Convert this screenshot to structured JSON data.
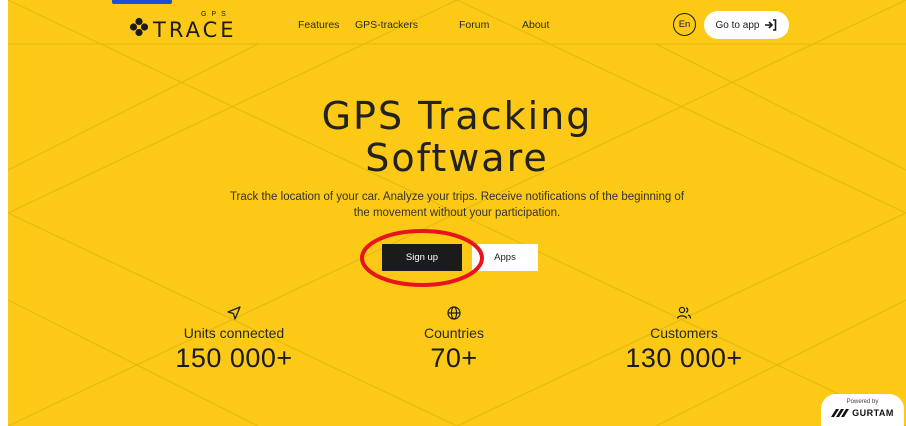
{
  "header": {
    "logo_main": "TRACE",
    "logo_sup": "GPS",
    "nav": {
      "features": "Features",
      "trackers": "GPS-trackers",
      "forum": "Forum",
      "about": "About"
    },
    "language": "En",
    "goto_label": "Go to app"
  },
  "hero": {
    "title_line1": "GPS Tracking",
    "title_line2": "Software",
    "subtitle": "Track the location of your car. Analyze your trips. Receive notifications of the beginning of the movement without your participation.",
    "signup_label": "Sign up",
    "apps_label": "Apps"
  },
  "stats": [
    {
      "icon": "navigation-arrow-icon",
      "label": "Units connected",
      "value": "150 000+"
    },
    {
      "icon": "globe-icon",
      "label": "Countries",
      "value": "70+"
    },
    {
      "icon": "users-icon",
      "label": "Customers",
      "value": "130 000+"
    }
  ],
  "footer": {
    "powered_by": "Powered by",
    "brand": "GURTAM"
  },
  "colors": {
    "background": "#fcc917",
    "dark": "#1b1b1b",
    "annotation": "#e8141b",
    "header_cut": "#1a4fd6"
  }
}
